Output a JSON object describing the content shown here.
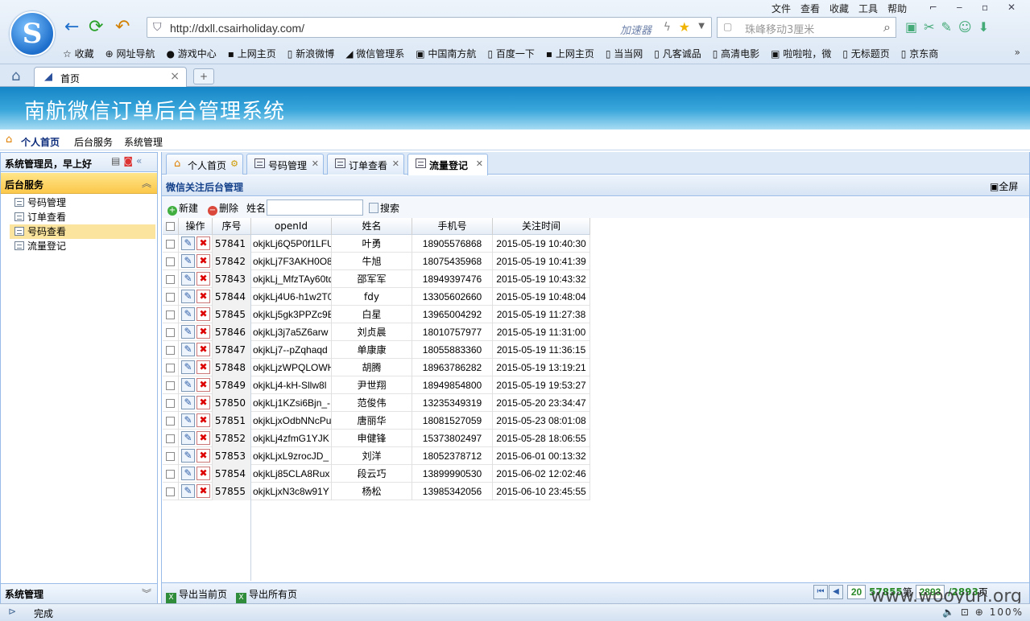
{
  "browser": {
    "menu": [
      "文件",
      "查看",
      "收藏",
      "工具",
      "帮助"
    ],
    "url": "http://dxll.csairholiday.com/",
    "accelerator_label": "加速器",
    "search_placeholder": "珠峰移动3厘米",
    "bookmarks": [
      "收藏",
      "网址导航",
      "游戏中心",
      "上网主页",
      "新浪微博",
      "微信管理系",
      "中国南方航",
      "百度一下",
      "上网主页",
      "当当网",
      "凡客诚品",
      "高清电影",
      "啦啦啦，微",
      "无标题页",
      "京东商"
    ],
    "bookmarks_more": "»",
    "tab_label": "首页",
    "status_text": "完成",
    "zoom": "100%"
  },
  "app": {
    "title": "南航微信订单后台管理系统",
    "nav": {
      "home": "个人首页",
      "backend": "后台服务",
      "system": "系统管理"
    },
    "welcome": "系统管理员，早上好",
    "accordion_backend": "后台服务",
    "accordion_system": "系统管理",
    "tree": [
      "号码管理",
      "订单查看",
      "号码查看",
      "流量登记"
    ],
    "tree_selected_index": 2,
    "tabs": [
      "个人首页",
      "号码管理",
      "订单查看",
      "流量登记"
    ],
    "active_tab": "流量登记",
    "panel_title": "微信关注后台管理",
    "fullscreen_label": "全屏",
    "toolbar": {
      "new_label": "新建",
      "delete_label": "删除",
      "name_label": "姓名",
      "search_label": "搜索"
    },
    "grid": {
      "columns": [
        "操作",
        "序号",
        "openId",
        "姓名",
        "手机号",
        "关注时间"
      ],
      "rows": [
        {
          "seq": "57841",
          "openid": "okjkLj6Q5P0f1LFU",
          "name": "叶勇",
          "phone": "18905576868",
          "time": "2015-05-19 10:40:30"
        },
        {
          "seq": "57842",
          "openid": "okjkLj7F3AKH0O8",
          "name": "牛旭",
          "phone": "18075435968",
          "time": "2015-05-19 10:41:39"
        },
        {
          "seq": "57843",
          "openid": "okjkLj_MfzTAy60tq",
          "name": "邵军军",
          "phone": "18949397476",
          "time": "2015-05-19 10:43:32"
        },
        {
          "seq": "57844",
          "openid": "okjkLj4U6-h1w2T0",
          "name": "fdy",
          "phone": "13305602660",
          "time": "2015-05-19 10:48:04"
        },
        {
          "seq": "57845",
          "openid": "okjkLj5gk3PPZc9E",
          "name": "白星",
          "phone": "13965004292",
          "time": "2015-05-19 11:27:38"
        },
        {
          "seq": "57846",
          "openid": "okjkLj3j7a5Z6arw",
          "name": "刘贞晨",
          "phone": "18010757977",
          "time": "2015-05-19 11:31:00"
        },
        {
          "seq": "57847",
          "openid": "okjkLj7--pZqhaqd",
          "name": "单康康",
          "phone": "18055883360",
          "time": "2015-05-19 11:36:15"
        },
        {
          "seq": "57848",
          "openid": "okjkLjzWPQLOWH",
          "name": "胡腾",
          "phone": "18963786282",
          "time": "2015-05-19 13:19:21"
        },
        {
          "seq": "57849",
          "openid": "okjkLj4-kH-Sllw8l",
          "name": "尹世翔",
          "phone": "18949854800",
          "time": "2015-05-19 19:53:27"
        },
        {
          "seq": "57850",
          "openid": "okjkLj1KZsi6Bjn_-",
          "name": "范俊伟",
          "phone": "13235349319",
          "time": "2015-05-20 23:34:47"
        },
        {
          "seq": "57851",
          "openid": "okjkLjxOdbNNcPu",
          "name": "唐丽华",
          "phone": "18081527059",
          "time": "2015-05-23 08:01:08"
        },
        {
          "seq": "57852",
          "openid": "okjkLj4zfmG1YJK",
          "name": "申健锋",
          "phone": "15373802497",
          "time": "2015-05-28 18:06:55"
        },
        {
          "seq": "57853",
          "openid": "okjkLjxL9zrocJD_",
          "name": "刘洋",
          "phone": "18052378712",
          "time": "2015-06-01 00:13:32"
        },
        {
          "seq": "57854",
          "openid": "okjkLj85CLA8Rux",
          "name": "段云巧",
          "phone": "13899990530",
          "time": "2015-06-02 12:02:46"
        },
        {
          "seq": "57855",
          "openid": "okjkLjxN3c8w91Y",
          "name": "杨松",
          "phone": "13985342056",
          "time": "2015-06-10 23:45:55"
        }
      ]
    },
    "footer": {
      "export_current": "导出当前页",
      "export_all": "导出所有页",
      "page_size": "20",
      "total_records": "57855",
      "page_prefix": "第",
      "current_page": "2893",
      "total_pages": "/2893",
      "page_suffix": "页"
    },
    "watermark": "www.wooyun.org"
  }
}
